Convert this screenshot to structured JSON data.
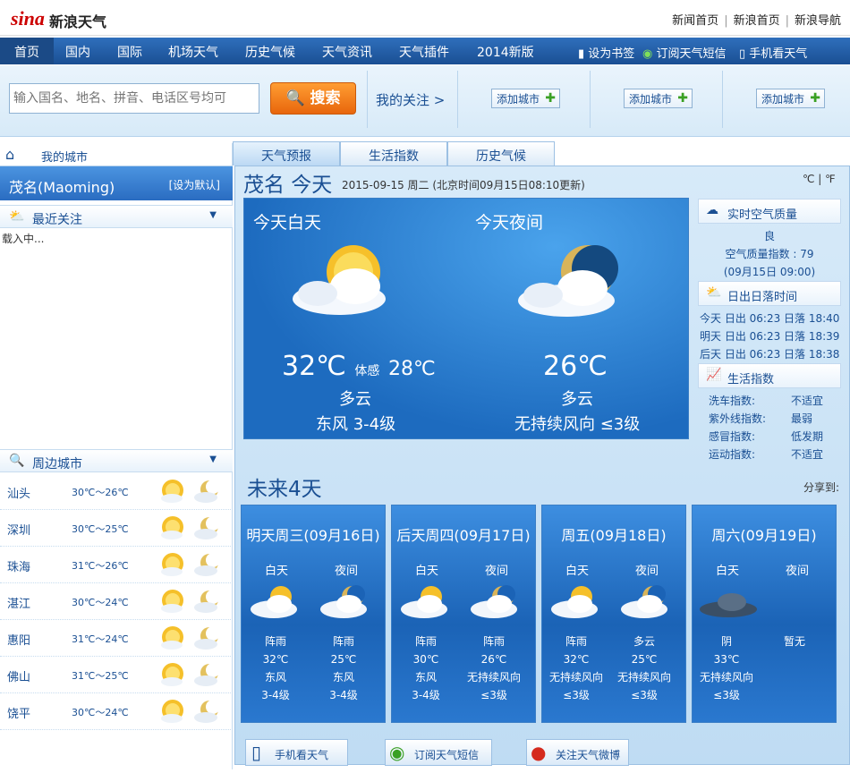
{
  "topbar": {
    "logo": "sina",
    "logo_sub": "新浪天气",
    "links": [
      "新闻首页",
      "新浪首页",
      "新浪导航"
    ]
  },
  "nav": {
    "items": [
      "首页",
      "国内",
      "国际",
      "机场天气",
      "历史气候",
      "天气资讯",
      "天气插件",
      "2014新版"
    ],
    "right": [
      "设为书签",
      "订阅天气短信",
      "手机看天气"
    ]
  },
  "search": {
    "placeholder": "输入国名、地名、拼音、电话区号均可",
    "button": "搜索",
    "my_focus": "我的关注 >",
    "add_city": "添加城市"
  },
  "sidebar": {
    "my_city": "我的城市",
    "city_name": "茂名(Maoming)",
    "set_default": "[设为默认]",
    "recent": "最近关注",
    "loading": "载入中...",
    "nearby": "周边城市",
    "cities": [
      {
        "name": "汕头",
        "temp": "30℃～26℃"
      },
      {
        "name": "深圳",
        "temp": "30℃～25℃"
      },
      {
        "name": "珠海",
        "temp": "31℃～26℃"
      },
      {
        "name": "湛江",
        "temp": "30℃～24℃"
      },
      {
        "name": "惠阳",
        "temp": "31℃～24℃"
      },
      {
        "name": "佛山",
        "temp": "31℃～25℃"
      },
      {
        "name": "饶平",
        "temp": "30℃～24℃"
      }
    ]
  },
  "tabs": [
    "天气预报",
    "生活指数",
    "历史气候"
  ],
  "main": {
    "city_title": "茂名 今天",
    "date": "2015-09-15  周二 (北京时间09月15日08:10更新)",
    "units": "℃ | ℉",
    "today_day": {
      "label": "今天白天",
      "temp": "32℃",
      "feel_label": "体感",
      "feel": "28℃",
      "weather": "多云",
      "wind": "东风 3-4级"
    },
    "today_night": {
      "label": "今天夜间",
      "temp": "26℃",
      "weather": "多云",
      "wind": "无持续风向 ≤3级"
    },
    "air": {
      "title": "实时空气质量",
      "level": "良",
      "index": "空气质量指数 : 79",
      "time": "(09月15日 09:00)"
    },
    "sun": {
      "title": "日出日落时间",
      "rows": [
        "今天 日出 06:23 日落 18:40",
        "明天 日出 06:23 日落 18:39",
        "后天 日出 06:23 日落 18:38"
      ]
    },
    "life": {
      "title": "生活指数",
      "rows": [
        {
          "k": "洗车指数:",
          "v": "不适宜"
        },
        {
          "k": "紫外线指数:",
          "v": "最弱"
        },
        {
          "k": "感冒指数:",
          "v": "低发期"
        },
        {
          "k": "运动指数:",
          "v": "不适宜"
        }
      ]
    },
    "future_title": "未来4天",
    "share": "分享到:",
    "day_label": "白天",
    "night_label": "夜间",
    "days": [
      {
        "title": "明天周三(09月16日)",
        "day": [
          "阵雨",
          "32℃",
          "东风",
          "3-4级"
        ],
        "night": [
          "阵雨",
          "25℃",
          "东风",
          "3-4级"
        ]
      },
      {
        "title": "后天周四(09月17日)",
        "day": [
          "阵雨",
          "30℃",
          "东风",
          "3-4级"
        ],
        "night": [
          "阵雨",
          "26℃",
          "无持续风向",
          "≤3级"
        ]
      },
      {
        "title": "周五(09月18日)",
        "day": [
          "阵雨",
          "32℃",
          "无持续风向",
          "≤3级"
        ],
        "night": [
          "多云",
          "25℃",
          "无持续风向",
          "≤3级"
        ]
      },
      {
        "title": "周六(09月19日)",
        "day": [
          "阴",
          "33℃",
          "无持续风向",
          "≤3级"
        ],
        "night": [
          "暂无",
          "",
          "",
          ""
        ]
      }
    ]
  },
  "bottom": [
    "手机看天气",
    "订阅天气短信",
    "关注天气微博"
  ]
}
